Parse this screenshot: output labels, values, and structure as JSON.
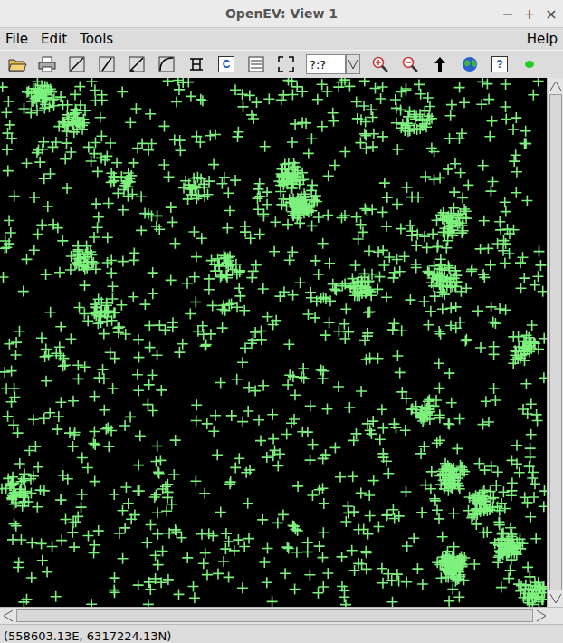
{
  "window": {
    "title": "OpenEV: View 1",
    "controls": [
      "−",
      "+",
      "×"
    ]
  },
  "menu": {
    "items": [
      "File",
      "Edit",
      "Tools"
    ],
    "help": "Help"
  },
  "toolbar": [
    {
      "kind": "open"
    },
    {
      "kind": "print"
    },
    {
      "kind": "line-a"
    },
    {
      "kind": "line-b"
    },
    {
      "kind": "line-c"
    },
    {
      "kind": "arc"
    },
    {
      "kind": "node"
    },
    {
      "kind": "legend",
      "label": "C"
    },
    {
      "kind": "layers"
    },
    {
      "kind": "fit"
    },
    {
      "kind": "zoom-field",
      "label": "?:?"
    },
    {
      "kind": "zoom-in"
    },
    {
      "kind": "zoom-out"
    },
    {
      "kind": "north"
    },
    {
      "kind": "globe"
    },
    {
      "kind": "help",
      "label": "?"
    },
    {
      "kind": "dot"
    }
  ],
  "status_bar": "(558603.13E, 6317224.13N)"
}
